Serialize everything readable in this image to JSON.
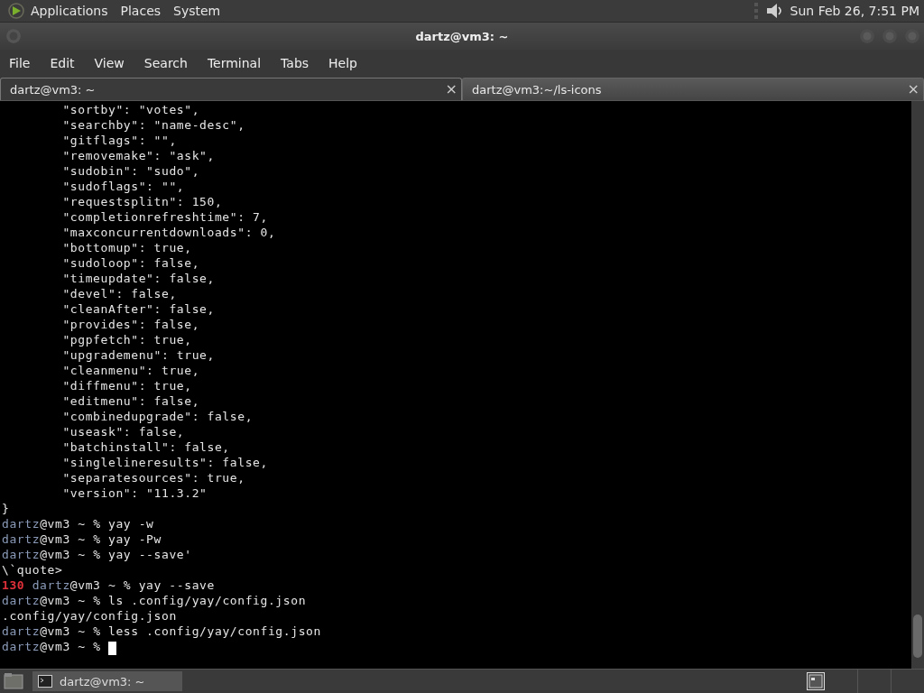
{
  "top_panel": {
    "menus": [
      "Applications",
      "Places",
      "System"
    ],
    "clock": "Sun Feb 26,  7:51 PM"
  },
  "window": {
    "title": "dartz@vm3: ~"
  },
  "menu_bar": [
    "File",
    "Edit",
    "View",
    "Search",
    "Terminal",
    "Tabs",
    "Help"
  ],
  "tabs": [
    {
      "label": "dartz@vm3: ~",
      "selected": true,
      "close": "×"
    },
    {
      "label": "dartz@vm3:~/ls-icons",
      "selected": false,
      "close": "×"
    }
  ],
  "terminal": {
    "lines": [
      {
        "kind": "output",
        "text": "        \"sortby\": \"votes\","
      },
      {
        "kind": "output",
        "text": "        \"searchby\": \"name-desc\","
      },
      {
        "kind": "output",
        "text": "        \"gitflags\": \"\","
      },
      {
        "kind": "output",
        "text": "        \"removemake\": \"ask\","
      },
      {
        "kind": "output",
        "text": "        \"sudobin\": \"sudo\","
      },
      {
        "kind": "output",
        "text": "        \"sudoflags\": \"\","
      },
      {
        "kind": "output",
        "text": "        \"requestsplitn\": 150,"
      },
      {
        "kind": "output",
        "text": "        \"completionrefreshtime\": 7,"
      },
      {
        "kind": "output",
        "text": "        \"maxconcurrentdownloads\": 0,"
      },
      {
        "kind": "output",
        "text": "        \"bottomup\": true,"
      },
      {
        "kind": "output",
        "text": "        \"sudoloop\": false,"
      },
      {
        "kind": "output",
        "text": "        \"timeupdate\": false,"
      },
      {
        "kind": "output",
        "text": "        \"devel\": false,"
      },
      {
        "kind": "output",
        "text": "        \"cleanAfter\": false,"
      },
      {
        "kind": "output",
        "text": "        \"provides\": false,"
      },
      {
        "kind": "output",
        "text": "        \"pgpfetch\": true,"
      },
      {
        "kind": "output",
        "text": "        \"upgrademenu\": true,"
      },
      {
        "kind": "output",
        "text": "        \"cleanmenu\": true,"
      },
      {
        "kind": "output",
        "text": "        \"diffmenu\": true,"
      },
      {
        "kind": "output",
        "text": "        \"editmenu\": false,"
      },
      {
        "kind": "output",
        "text": "        \"combinedupgrade\": false,"
      },
      {
        "kind": "output",
        "text": "        \"useask\": false,"
      },
      {
        "kind": "output",
        "text": "        \"batchinstall\": false,"
      },
      {
        "kind": "output",
        "text": "        \"singlelineresults\": false,"
      },
      {
        "kind": "output",
        "text": "        \"separatesources\": true,"
      },
      {
        "kind": "output",
        "text": "        \"version\": \"11.3.2\""
      },
      {
        "kind": "output",
        "text": "}"
      },
      {
        "kind": "prompt",
        "user": "dartz",
        "rest": "@vm3 ~ % yay -w"
      },
      {
        "kind": "prompt",
        "user": "dartz",
        "rest": "@vm3 ~ % yay -Pw"
      },
      {
        "kind": "prompt",
        "user": "dartz",
        "rest": "@vm3 ~ % yay --save'"
      },
      {
        "kind": "output",
        "text": "\\`quote>"
      },
      {
        "kind": "prompt",
        "status": "130",
        "user": "dartz",
        "rest": "@vm3 ~ % yay --save"
      },
      {
        "kind": "prompt",
        "user": "dartz",
        "rest": "@vm3 ~ % ls .config/yay/config.json"
      },
      {
        "kind": "output",
        "text": ".config/yay/config.json"
      },
      {
        "kind": "prompt",
        "user": "dartz",
        "rest": "@vm3 ~ % less .config/yay/config.json"
      },
      {
        "kind": "prompt",
        "user": "dartz",
        "rest": "@vm3 ~ % ",
        "cursor": true
      }
    ]
  },
  "taskbar": {
    "tasks": [
      {
        "label": "dartz@vm3: ~",
        "selected": true
      }
    ]
  }
}
